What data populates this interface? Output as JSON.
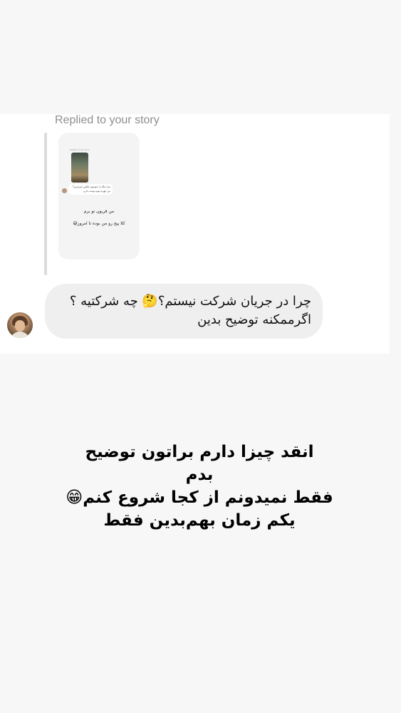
{
  "story_reply": {
    "replied_label": "Replied to your story",
    "thumbnail": {
      "header": "Replied to your story",
      "bubble_text": "چرا دیگه از خودتون عکس نمیزارین؟ من چهره تونو دوست دارم",
      "line1": "من قربون تو برم",
      "line2": "کلا پیج رو من بوده تا امروز😅"
    }
  },
  "message": {
    "line1": "چرا در جریان شرکت نیستم؟🤔 چه شرکتیه ؟",
    "line2": "اگرممکنه توضیح بدین"
  },
  "caption": {
    "line1": "انقد چیزا دارم براتون توضیح",
    "line2": "بدم",
    "line3": "فقط نمیدونم از کجا شروع کنم😁",
    "line4": "یکم زمان بهم‌بدین فقط"
  }
}
